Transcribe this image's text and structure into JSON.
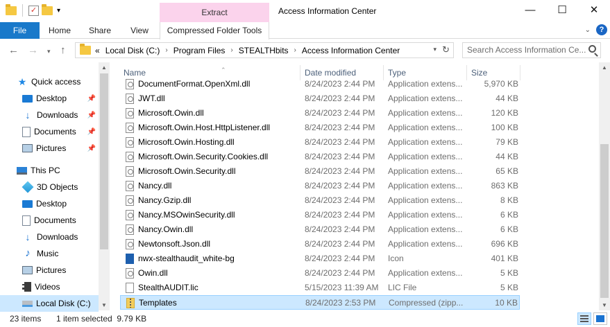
{
  "window": {
    "title": "Access Information Center",
    "context_tab_header": "Extract",
    "minimize": "—",
    "maximize": "☐",
    "close": "✕"
  },
  "ribbon": {
    "file": "File",
    "home": "Home",
    "share": "Share",
    "view": "View",
    "compressed_tools": "Compressed Folder Tools"
  },
  "address": {
    "overflow": "«",
    "crumbs": [
      "Local Disk (C:)",
      "Program Files",
      "STEALTHbits",
      "Access Information Center"
    ]
  },
  "search": {
    "placeholder": "Search Access Information Ce..."
  },
  "nav": {
    "quick_access": "Quick access",
    "qa_items": [
      "Desktop",
      "Downloads",
      "Documents",
      "Pictures"
    ],
    "this_pc": "This PC",
    "pc_items": [
      "3D Objects",
      "Desktop",
      "Documents",
      "Downloads",
      "Music",
      "Pictures",
      "Videos"
    ],
    "local_disk": "Local Disk (C:)"
  },
  "columns": {
    "name": "Name",
    "date": "Date modified",
    "type": "Type",
    "size": "Size"
  },
  "files": [
    {
      "name": "DocumentFormat.OpenXml.dll",
      "date": "8/24/2023 2:44 PM",
      "type": "Application extens...",
      "size": "5,970 KB",
      "icon": "dll"
    },
    {
      "name": "JWT.dll",
      "date": "8/24/2023 2:44 PM",
      "type": "Application extens...",
      "size": "44 KB",
      "icon": "dll"
    },
    {
      "name": "Microsoft.Owin.dll",
      "date": "8/24/2023 2:44 PM",
      "type": "Application extens...",
      "size": "120 KB",
      "icon": "dll"
    },
    {
      "name": "Microsoft.Owin.Host.HttpListener.dll",
      "date": "8/24/2023 2:44 PM",
      "type": "Application extens...",
      "size": "100 KB",
      "icon": "dll"
    },
    {
      "name": "Microsoft.Owin.Hosting.dll",
      "date": "8/24/2023 2:44 PM",
      "type": "Application extens...",
      "size": "79 KB",
      "icon": "dll"
    },
    {
      "name": "Microsoft.Owin.Security.Cookies.dll",
      "date": "8/24/2023 2:44 PM",
      "type": "Application extens...",
      "size": "44 KB",
      "icon": "dll"
    },
    {
      "name": "Microsoft.Owin.Security.dll",
      "date": "8/24/2023 2:44 PM",
      "type": "Application extens...",
      "size": "65 KB",
      "icon": "dll"
    },
    {
      "name": "Nancy.dll",
      "date": "8/24/2023 2:44 PM",
      "type": "Application extens...",
      "size": "863 KB",
      "icon": "dll"
    },
    {
      "name": "Nancy.Gzip.dll",
      "date": "8/24/2023 2:44 PM",
      "type": "Application extens...",
      "size": "8 KB",
      "icon": "dll"
    },
    {
      "name": "Nancy.MSOwinSecurity.dll",
      "date": "8/24/2023 2:44 PM",
      "type": "Application extens...",
      "size": "6 KB",
      "icon": "dll"
    },
    {
      "name": "Nancy.Owin.dll",
      "date": "8/24/2023 2:44 PM",
      "type": "Application extens...",
      "size": "6 KB",
      "icon": "dll"
    },
    {
      "name": "Newtonsoft.Json.dll",
      "date": "8/24/2023 2:44 PM",
      "type": "Application extens...",
      "size": "696 KB",
      "icon": "dll"
    },
    {
      "name": "nwx-stealthaudit_white-bg",
      "date": "8/24/2023 2:44 PM",
      "type": "Icon",
      "size": "401 KB",
      "icon": "ico"
    },
    {
      "name": "Owin.dll",
      "date": "8/24/2023 2:44 PM",
      "type": "Application extens...",
      "size": "5 KB",
      "icon": "dll"
    },
    {
      "name": "StealthAUDIT.lic",
      "date": "5/15/2023 11:39 AM",
      "type": "LIC File",
      "size": "5 KB",
      "icon": "file"
    },
    {
      "name": "Templates",
      "date": "8/24/2023 2:53 PM",
      "type": "Compressed (zipp...",
      "size": "10 KB",
      "icon": "zip",
      "selected": true
    }
  ],
  "status": {
    "count": "23 items",
    "selection": "1 item selected  9.79 KB"
  }
}
